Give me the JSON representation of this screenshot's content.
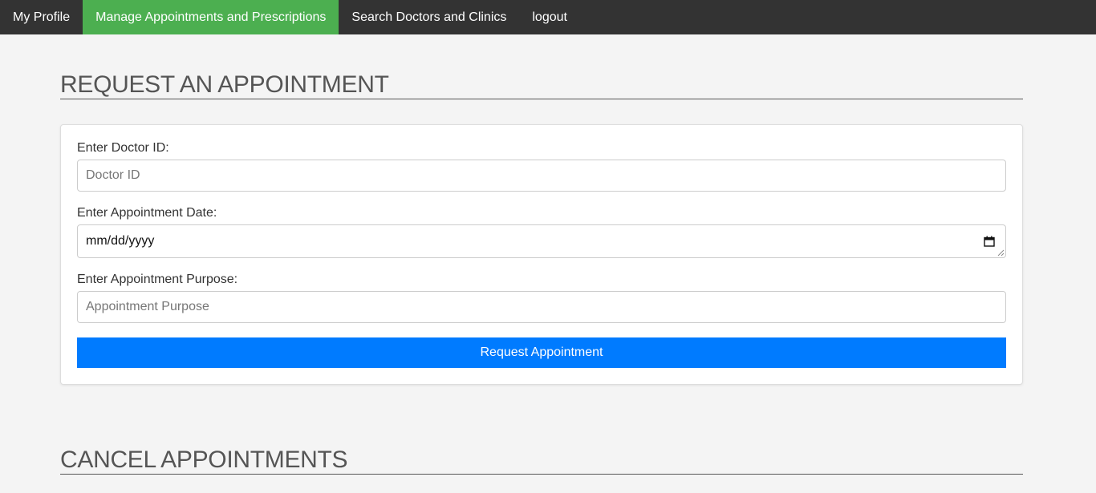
{
  "nav": {
    "items": [
      {
        "label": "My Profile",
        "active": false
      },
      {
        "label": "Manage Appointments and Prescriptions",
        "active": true
      },
      {
        "label": "Search Doctors and Clinics",
        "active": false
      },
      {
        "label": "logout",
        "active": false
      }
    ],
    "background_color": "#333333",
    "active_color": "#4caf50"
  },
  "request_section": {
    "title": "REQUEST AN APPOINTMENT",
    "form": {
      "doctor_id": {
        "label": "Enter Doctor ID:",
        "placeholder": "Doctor ID",
        "value": ""
      },
      "date": {
        "label": "Enter Appointment Date:",
        "display_value": "mm/dd/yyyy",
        "icon": "calendar-icon"
      },
      "purpose": {
        "label": "Enter Appointment Purpose:",
        "placeholder": "Appointment Purpose",
        "value": ""
      },
      "submit_label": "Request Appointment",
      "submit_color": "#007bff"
    }
  },
  "cancel_section": {
    "title": "CANCEL APPOINTMENTS"
  }
}
